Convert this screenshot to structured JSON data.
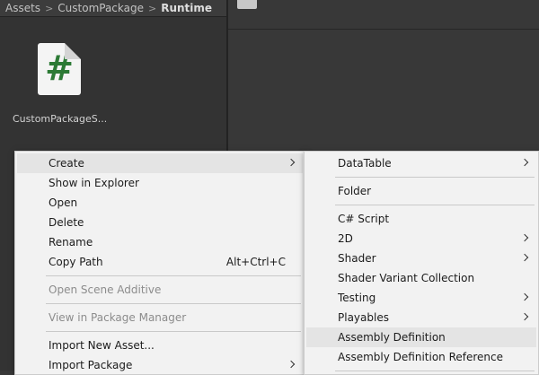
{
  "breadcrumb": [
    "Assets",
    "CustomPackage",
    "Runtime"
  ],
  "asset": {
    "label": "CustomPackageS...",
    "icon": "csharp-script-icon"
  },
  "context_menu": {
    "items": [
      {
        "label": "Create",
        "submenu": true,
        "highlighted": true
      },
      {
        "label": "Show in Explorer"
      },
      {
        "label": "Open"
      },
      {
        "label": "Delete"
      },
      {
        "label": "Rename"
      },
      {
        "label": "Copy Path",
        "shortcut": "Alt+Ctrl+C"
      },
      {
        "separator": true
      },
      {
        "label": "Open Scene Additive",
        "disabled": true
      },
      {
        "separator": true
      },
      {
        "label": "View in Package Manager",
        "disabled": true
      },
      {
        "separator": true
      },
      {
        "label": "Import New Asset..."
      },
      {
        "label": "Import Package",
        "submenu": true
      }
    ]
  },
  "create_submenu": {
    "items": [
      {
        "label": "DataTable",
        "submenu": true
      },
      {
        "separator": true
      },
      {
        "label": "Folder"
      },
      {
        "separator": true
      },
      {
        "label": "C# Script"
      },
      {
        "label": "2D",
        "submenu": true
      },
      {
        "label": "Shader",
        "submenu": true
      },
      {
        "label": "Shader Variant Collection"
      },
      {
        "label": "Testing",
        "submenu": true
      },
      {
        "label": "Playables",
        "submenu": true
      },
      {
        "label": "Assembly Definition",
        "highlighted": true
      },
      {
        "label": "Assembly Definition Reference"
      },
      {
        "separator": true
      }
    ]
  },
  "colors": {
    "menu_bg": "#f2f2f2",
    "highlight": "#e4e4e4",
    "script_icon_hash": "#2c7a35",
    "disabled_text": "#8c8c8c"
  }
}
